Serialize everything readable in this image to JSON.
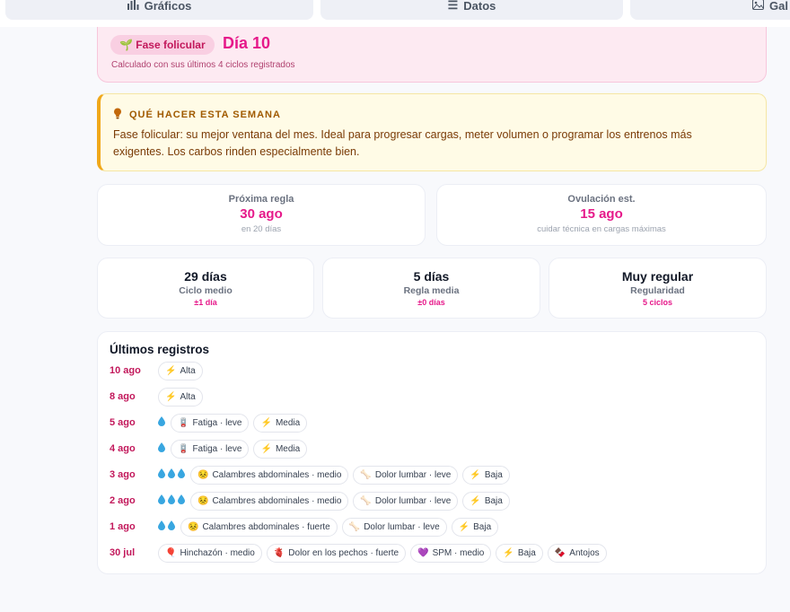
{
  "tabs": [
    {
      "icon": "bar-chart-icon",
      "label": "Gráficos"
    },
    {
      "icon": "list-icon",
      "label": "Datos"
    },
    {
      "icon": "gallery-icon",
      "label": "Gal"
    }
  ],
  "phase": {
    "badge": "🌱 Fase folicular",
    "day": "Día 10",
    "subtitle": "Calculado con sus últimos 4 ciclos registrados"
  },
  "advice": {
    "title": "QUÉ HACER ESTA SEMANA",
    "text": "Fase folicular: su mejor ventana del mes. Ideal para progresar cargas, meter volumen o programar los entrenos más exigentes. Los carbos rinden especialmente bien."
  },
  "predictions": [
    {
      "label": "Próxima regla",
      "value": "30 ago",
      "sub": "en 20 días"
    },
    {
      "label": "Ovulación est.",
      "value": "15 ago",
      "sub": "cuidar técnica en cargas máximas"
    }
  ],
  "metrics": [
    {
      "value": "29 días",
      "label": "Ciclo medio",
      "sub": "±1 día"
    },
    {
      "value": "5 días",
      "label": "Regla media",
      "sub": "±0 días"
    },
    {
      "value": "Muy regular",
      "label": "Regularidad",
      "sub": "5 ciclos"
    }
  ],
  "records": {
    "title": "Últimos registros",
    "rows": [
      {
        "date": "10 ago",
        "drops": 0,
        "chips": [
          {
            "icon": "⚡",
            "text": "Alta"
          }
        ]
      },
      {
        "date": "8 ago",
        "drops": 0,
        "chips": [
          {
            "icon": "⚡",
            "text": "Alta"
          }
        ]
      },
      {
        "date": "5 ago",
        "drops": 1,
        "chips": [
          {
            "icon": "🪫",
            "text": "Fatiga · leve"
          },
          {
            "icon": "⚡",
            "text": "Media"
          }
        ]
      },
      {
        "date": "4 ago",
        "drops": 1,
        "chips": [
          {
            "icon": "🪫",
            "text": "Fatiga · leve"
          },
          {
            "icon": "⚡",
            "text": "Media"
          }
        ]
      },
      {
        "date": "3 ago",
        "drops": 3,
        "chips": [
          {
            "icon": "😣",
            "text": "Calambres abdominales · medio"
          },
          {
            "icon": "🦴",
            "text": "Dolor lumbar · leve"
          },
          {
            "icon": "⚡",
            "text": "Baja"
          }
        ]
      },
      {
        "date": "2 ago",
        "drops": 3,
        "chips": [
          {
            "icon": "😣",
            "text": "Calambres abdominales · medio"
          },
          {
            "icon": "🦴",
            "text": "Dolor lumbar · leve"
          },
          {
            "icon": "⚡",
            "text": "Baja"
          }
        ]
      },
      {
        "date": "1 ago",
        "drops": 2,
        "chips": [
          {
            "icon": "😣",
            "text": "Calambres abdominales · fuerte"
          },
          {
            "icon": "🦴",
            "text": "Dolor lumbar · leve"
          },
          {
            "icon": "⚡",
            "text": "Baja"
          }
        ]
      },
      {
        "date": "30 jul",
        "drops": 0,
        "chips": [
          {
            "icon": "🎈",
            "text": "Hinchazón · medio"
          },
          {
            "icon": "🫀",
            "text": "Dolor en los pechos · fuerte"
          },
          {
            "icon": "💜",
            "text": "SPM · medio"
          },
          {
            "icon": "⚡",
            "text": "Baja"
          },
          {
            "icon": "🍫",
            "text": "Antojos"
          }
        ]
      }
    ]
  },
  "colors": {
    "accent": "#e6198a",
    "date": "#c2185b",
    "drop": "#38a6e0",
    "advice_border": "#f0a81a"
  }
}
